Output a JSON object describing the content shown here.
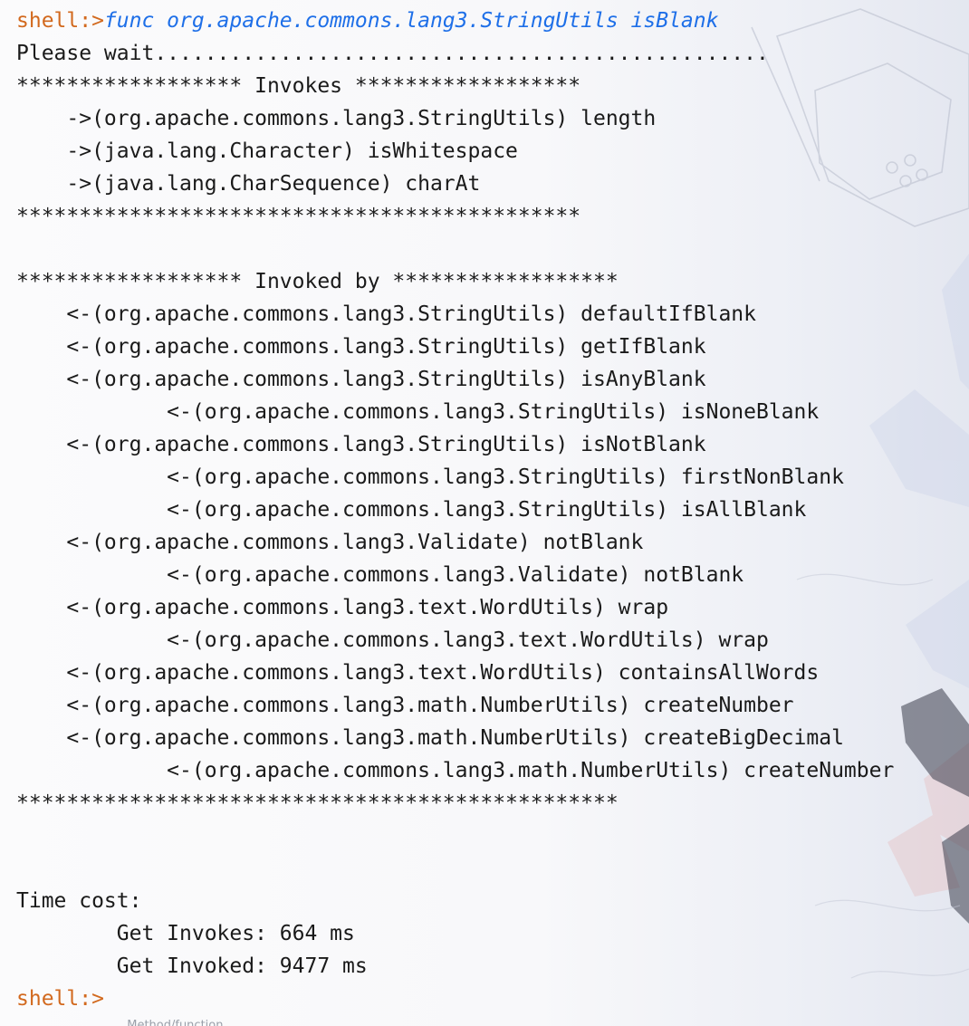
{
  "terminal": {
    "lines": [
      {
        "indent": 0,
        "prompt": "shell:>",
        "text": "func org.apache.commons.lang3.StringUtils isBlank",
        "kind": "command"
      },
      {
        "indent": 0,
        "text": "Please wait.................................................",
        "kind": "plain"
      },
      {
        "indent": 0,
        "text": "****************** Invokes ******************",
        "kind": "separator"
      },
      {
        "indent": 4,
        "text": "->(org.apache.commons.lang3.StringUtils) length",
        "kind": "invokes"
      },
      {
        "indent": 4,
        "text": "->(java.lang.Character) isWhitespace",
        "kind": "invokes"
      },
      {
        "indent": 4,
        "text": "->(java.lang.CharSequence) charAt",
        "kind": "invokes"
      },
      {
        "indent": 0,
        "text": "*********************************************",
        "kind": "separator"
      },
      {
        "indent": 0,
        "text": "",
        "kind": "blank"
      },
      {
        "indent": 0,
        "text": "****************** Invoked by ******************",
        "kind": "separator"
      },
      {
        "indent": 4,
        "text": "<-(org.apache.commons.lang3.StringUtils) defaultIfBlank",
        "kind": "invoked"
      },
      {
        "indent": 4,
        "text": "<-(org.apache.commons.lang3.StringUtils) getIfBlank",
        "kind": "invoked"
      },
      {
        "indent": 4,
        "text": "<-(org.apache.commons.lang3.StringUtils) isAnyBlank",
        "kind": "invoked"
      },
      {
        "indent": 12,
        "text": "<-(org.apache.commons.lang3.StringUtils) isNoneBlank",
        "kind": "invoked"
      },
      {
        "indent": 4,
        "text": "<-(org.apache.commons.lang3.StringUtils) isNotBlank",
        "kind": "invoked"
      },
      {
        "indent": 12,
        "text": "<-(org.apache.commons.lang3.StringUtils) firstNonBlank",
        "kind": "invoked"
      },
      {
        "indent": 12,
        "text": "<-(org.apache.commons.lang3.StringUtils) isAllBlank",
        "kind": "invoked"
      },
      {
        "indent": 4,
        "text": "<-(org.apache.commons.lang3.Validate) notBlank",
        "kind": "invoked"
      },
      {
        "indent": 12,
        "text": "<-(org.apache.commons.lang3.Validate) notBlank",
        "kind": "invoked"
      },
      {
        "indent": 4,
        "text": "<-(org.apache.commons.lang3.text.WordUtils) wrap",
        "kind": "invoked"
      },
      {
        "indent": 12,
        "text": "<-(org.apache.commons.lang3.text.WordUtils) wrap",
        "kind": "invoked"
      },
      {
        "indent": 4,
        "text": "<-(org.apache.commons.lang3.text.WordUtils) containsAllWords",
        "kind": "invoked"
      },
      {
        "indent": 4,
        "text": "<-(org.apache.commons.lang3.math.NumberUtils) createNumber",
        "kind": "invoked"
      },
      {
        "indent": 4,
        "text": "<-(org.apache.commons.lang3.math.NumberUtils) createBigDecimal",
        "kind": "invoked"
      },
      {
        "indent": 12,
        "text": "<-(org.apache.commons.lang3.math.NumberUtils) createNumber",
        "kind": "invoked"
      },
      {
        "indent": 0,
        "text": "************************************************",
        "kind": "separator"
      },
      {
        "indent": 0,
        "text": "",
        "kind": "blank"
      },
      {
        "indent": 0,
        "text": "",
        "kind": "blank"
      },
      {
        "indent": 0,
        "text": "Time cost:",
        "kind": "plain"
      },
      {
        "indent": 8,
        "text": "Get Invokes: 664 ms",
        "kind": "plain"
      },
      {
        "indent": 8,
        "text": "Get Invoked: 9477 ms",
        "kind": "plain"
      },
      {
        "indent": 0,
        "prompt": "shell:>",
        "text": "",
        "kind": "prompt"
      }
    ]
  },
  "status_strip": {
    "text": "...  ...  ...  ...  ...  ...  ...  ...  Method/function"
  },
  "colors": {
    "prompt": "#d2691e",
    "command": "#1e6fe8",
    "text": "#1a1a1a",
    "background": "#f8f8fa"
  }
}
